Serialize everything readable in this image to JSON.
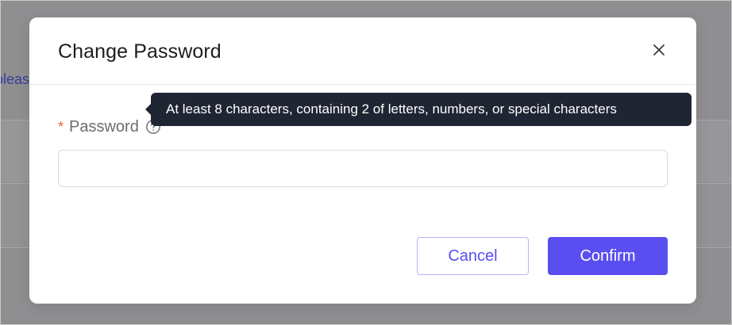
{
  "background": {
    "partial_text": "pleas"
  },
  "dialog": {
    "title": "Change Password",
    "close_icon": "close-icon",
    "field": {
      "required_mark": "*",
      "label": "Password",
      "help_icon": "question-circle-icon",
      "value": "",
      "placeholder": ""
    },
    "tooltip": "At least 8 characters, containing 2 of letters, numbers, or special characters",
    "buttons": {
      "cancel": "Cancel",
      "confirm": "Confirm"
    }
  },
  "colors": {
    "primary": "#5b4ef0",
    "required": "#e8622a",
    "tooltip_bg": "#1f2533"
  }
}
